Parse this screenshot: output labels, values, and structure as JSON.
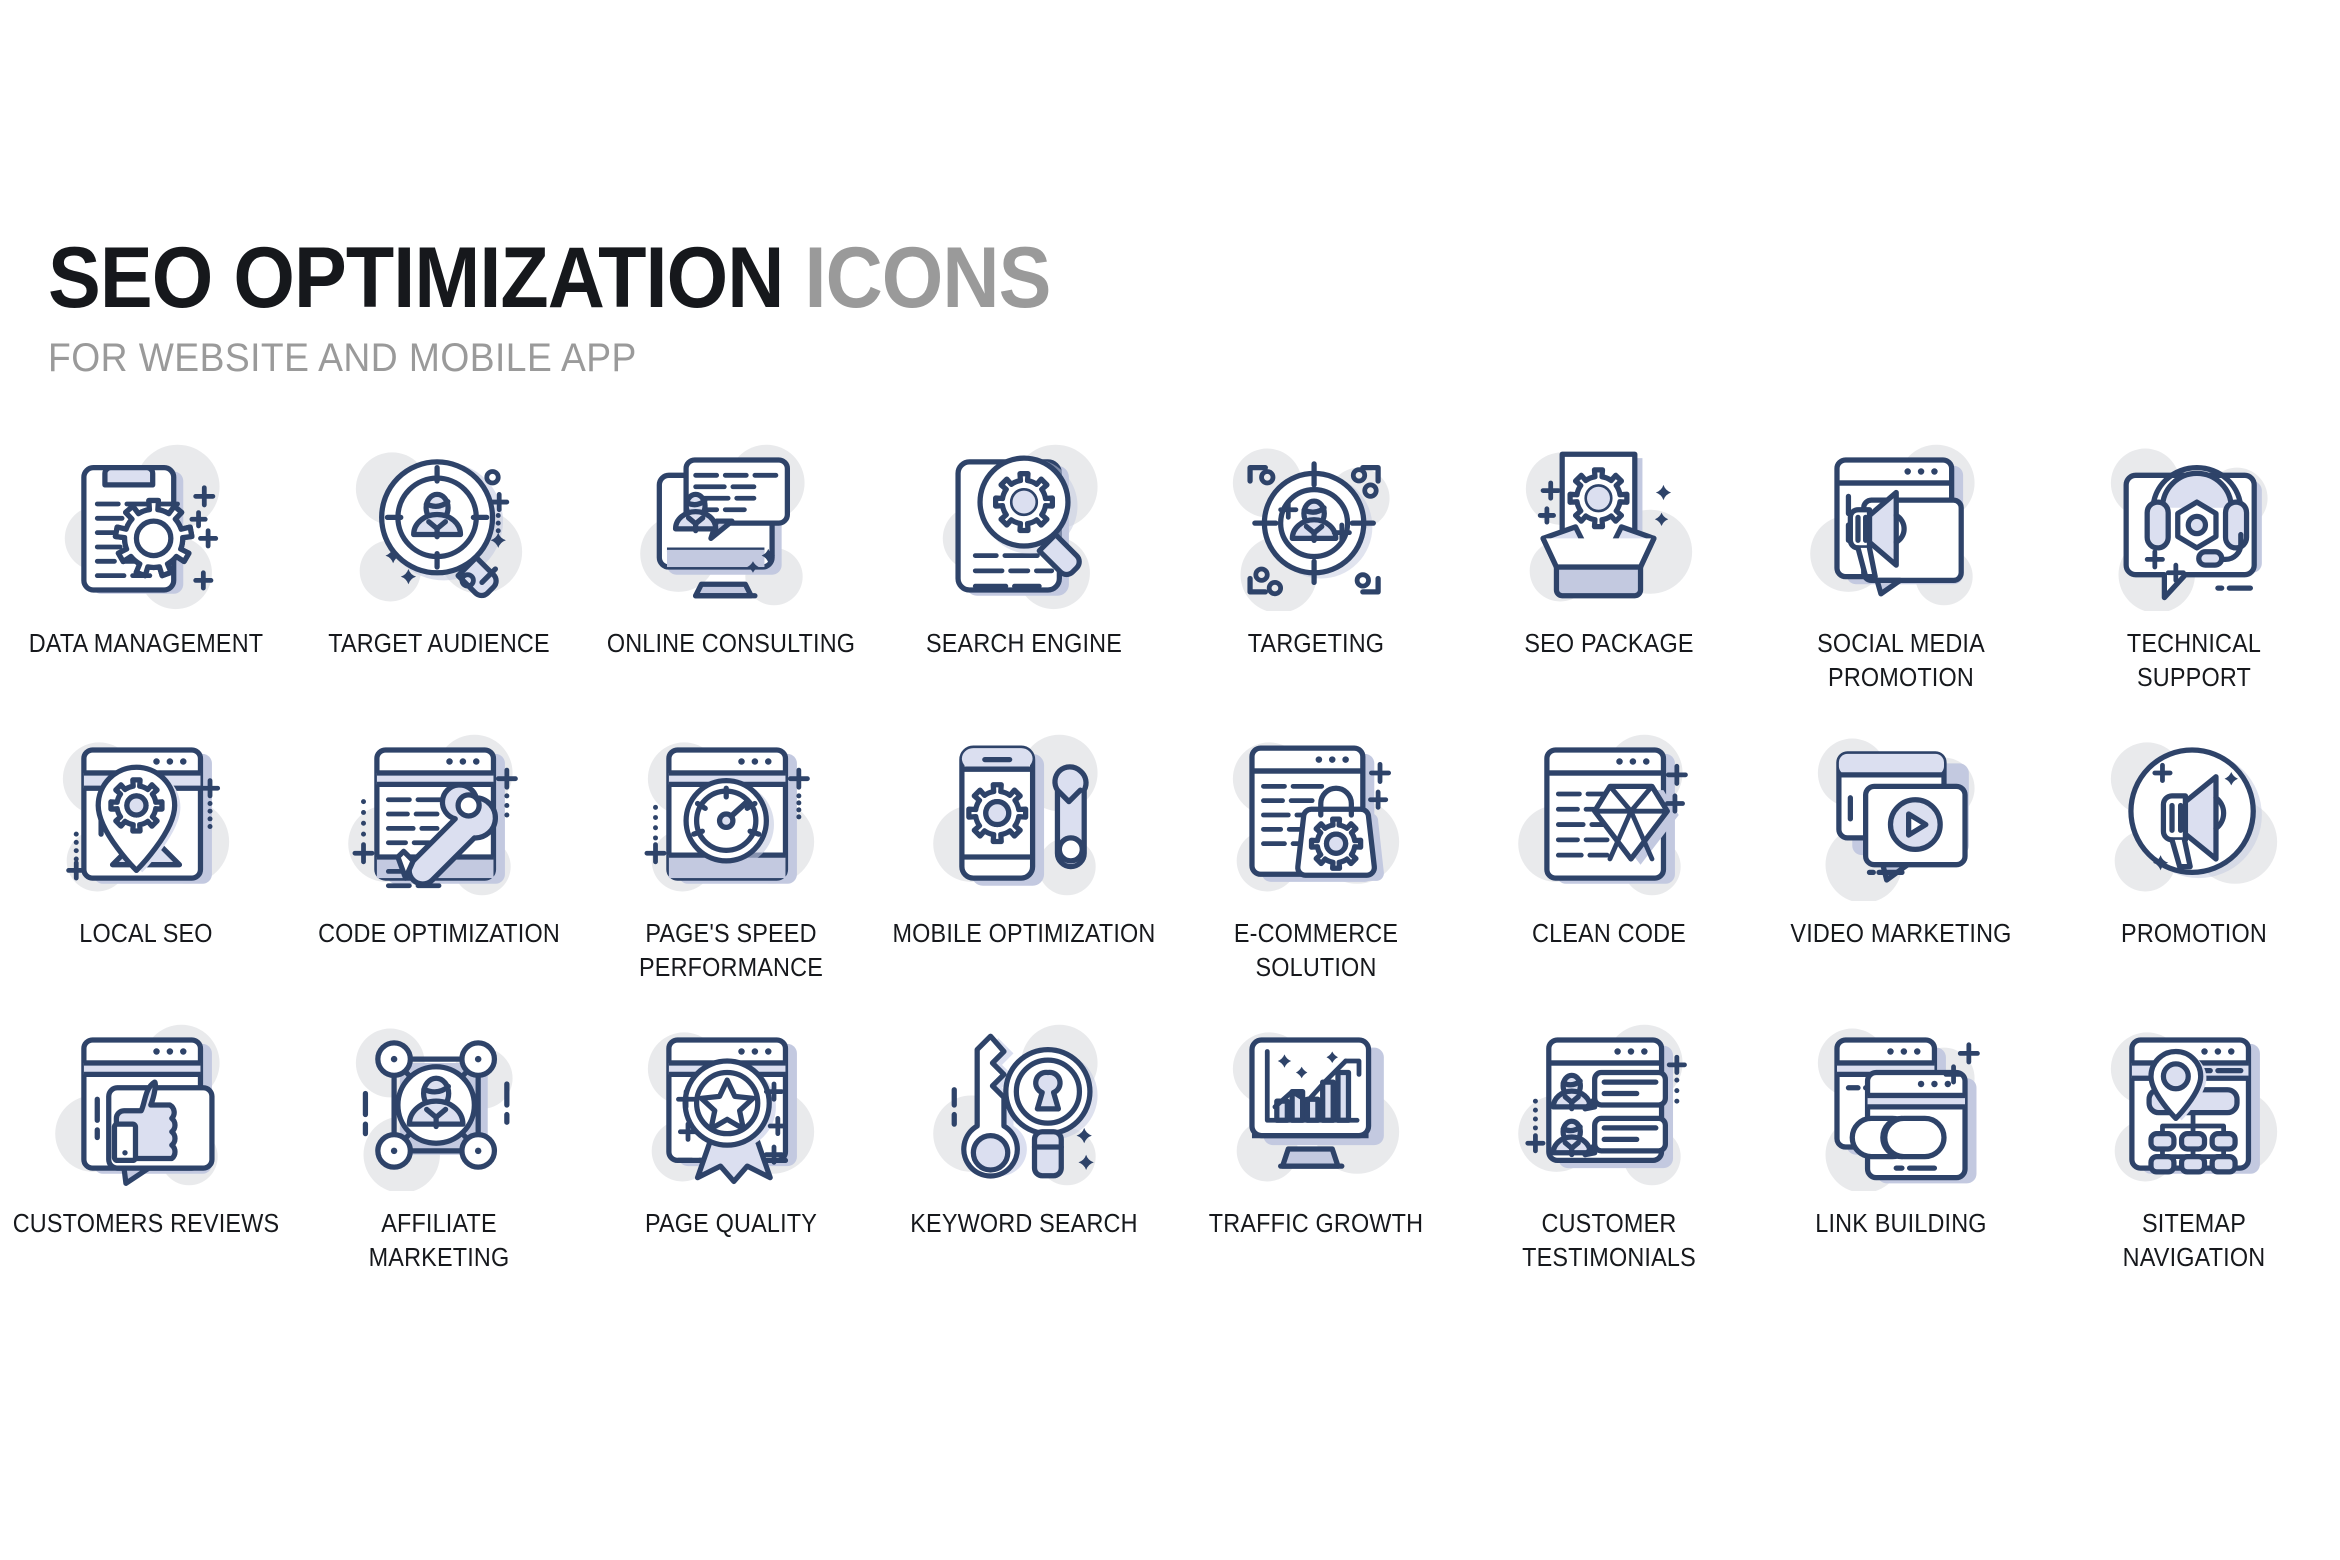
{
  "header": {
    "title_main": "SEO OPTIMIZATION",
    "title_accent": "ICONS",
    "subtitle": "FOR WEBSITE AND MOBILE APP"
  },
  "colors": {
    "stroke": "#2e4369",
    "shade": "#c3c9e0",
    "shade_light": "#dbdff0",
    "blob": "#e9eaec",
    "white": "#ffffff",
    "title_main": "#16181c",
    "title_accent": "#9a9a9a",
    "label": "#16181c"
  },
  "grid": {
    "columns": 8,
    "rows": 3
  },
  "icons": [
    {
      "id": "data-management",
      "label": "DATA MANAGEMENT",
      "glyph": "clipboard-gear-icon"
    },
    {
      "id": "target-audience",
      "label": "TARGET AUDIENCE",
      "glyph": "magnifier-person-icon"
    },
    {
      "id": "online-consulting",
      "label": "ONLINE CONSULTING",
      "glyph": "monitor-chat-person-icon"
    },
    {
      "id": "search-engine",
      "label": "SEARCH ENGINE",
      "glyph": "magnifier-gear-document-icon"
    },
    {
      "id": "targeting",
      "label": "TARGETING",
      "glyph": "crosshair-person-icon"
    },
    {
      "id": "seo-package",
      "label": "SEO PACKAGE",
      "glyph": "open-box-gear-icon"
    },
    {
      "id": "social-media-promotion",
      "label": "SOCIAL MEDIA\nPROMOTION",
      "glyph": "browser-megaphone-icon"
    },
    {
      "id": "technical-support",
      "label": "TECHNICAL\nSUPPORT",
      "glyph": "headset-chat-icon"
    },
    {
      "id": "local-seo",
      "label": "LOCAL SEO",
      "glyph": "browser-map-pin-gear-icon"
    },
    {
      "id": "code-optimization",
      "label": "CODE OPTIMIZATION",
      "glyph": "browser-wrench-icon"
    },
    {
      "id": "pages-speed-performance",
      "label": "PAGE'S SPEED\nPERFORMANCE",
      "glyph": "browser-speedometer-icon"
    },
    {
      "id": "mobile-optimization",
      "label": "MOBILE OPTIMIZATION",
      "glyph": "phone-gear-wrench-icon"
    },
    {
      "id": "e-commerce-solution",
      "label": "E-COMMERCE\nSOLUTION",
      "glyph": "browser-shopping-bag-gear-icon"
    },
    {
      "id": "clean-code",
      "label": "CLEAN CODE",
      "glyph": "browser-diamond-icon"
    },
    {
      "id": "video-marketing",
      "label": "VIDEO MARKETING",
      "glyph": "monitor-play-icon"
    },
    {
      "id": "promotion",
      "label": "PROMOTION",
      "glyph": "circle-megaphone-icon"
    },
    {
      "id": "customers-reviews",
      "label": "CUSTOMERS REVIEWS",
      "glyph": "browser-thumbs-up-icon"
    },
    {
      "id": "affiliate-marketing",
      "label": "AFFILIATE\nMARKETING",
      "glyph": "network-person-icon"
    },
    {
      "id": "page-quality",
      "label": "PAGE QUALITY",
      "glyph": "browser-award-star-icon"
    },
    {
      "id": "keyword-search",
      "label": "KEYWORD SEARCH",
      "glyph": "key-magnifier-icon"
    },
    {
      "id": "traffic-growth",
      "label": "TRAFFIC GROWTH",
      "glyph": "monitor-growth-chart-icon"
    },
    {
      "id": "customer-testimonials",
      "label": "CUSTOMER\nTESTIMONIALS",
      "glyph": "two-person-chat-icon"
    },
    {
      "id": "link-building",
      "label": "LINK BUILDING",
      "glyph": "browsers-chain-link-icon"
    },
    {
      "id": "sitemap-navigation",
      "label": "SITEMAP\nNAVIGATION",
      "glyph": "browser-sitemap-pin-icon"
    }
  ]
}
